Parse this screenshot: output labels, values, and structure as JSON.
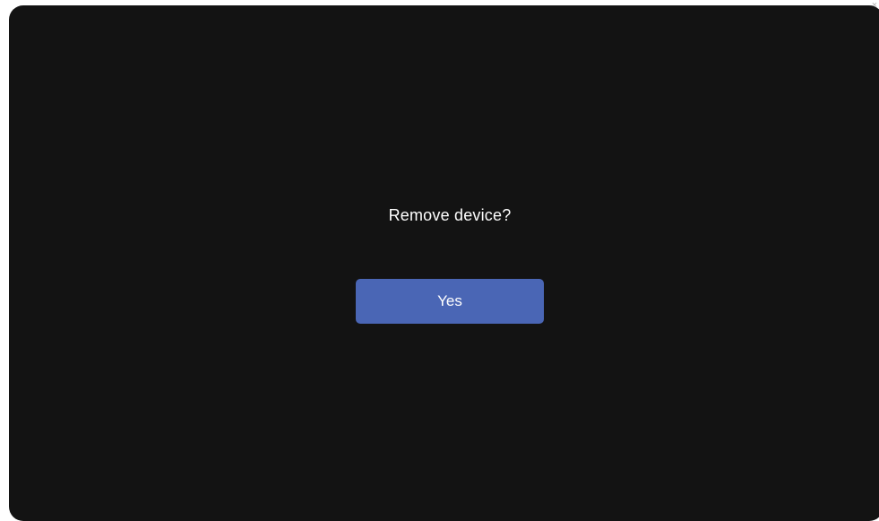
{
  "dialog": {
    "title": "Remove device?",
    "confirm_label": "Yes"
  },
  "corner": {
    "close_glyph": "×"
  },
  "colors": {
    "background": "#131313",
    "accent": "#4a66b5",
    "text": "#ffffff"
  }
}
